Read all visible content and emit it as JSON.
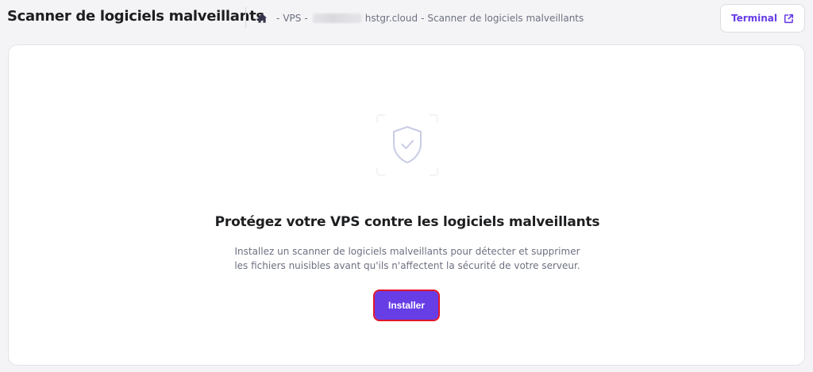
{
  "header": {
    "title": "Scanner de logiciels malveillants",
    "breadcrumb": {
      "home_icon": "home-icon",
      "separator": "-",
      "vps": "VPS",
      "host_suffix": "hstgr.cloud",
      "current": "Scanner de logiciels malveillants"
    },
    "terminal_button": {
      "label": "Terminal",
      "icon": "external-link-icon"
    }
  },
  "main": {
    "illustration_icon": "shield-check-icon",
    "heading": "Protégez votre VPS contre les logiciels malveillants",
    "description_line1": "Installez un scanner de logiciels malveillants pour détecter et supprimer",
    "description_line2": "les fichiers nuisibles avant qu'ils n'affectent la sécurité de votre serveur.",
    "install_button": "Installer"
  },
  "colors": {
    "accent": "#673de6",
    "highlight_border": "#e0162b",
    "text_primary": "#1d1e20",
    "text_secondary": "#6d7081"
  }
}
